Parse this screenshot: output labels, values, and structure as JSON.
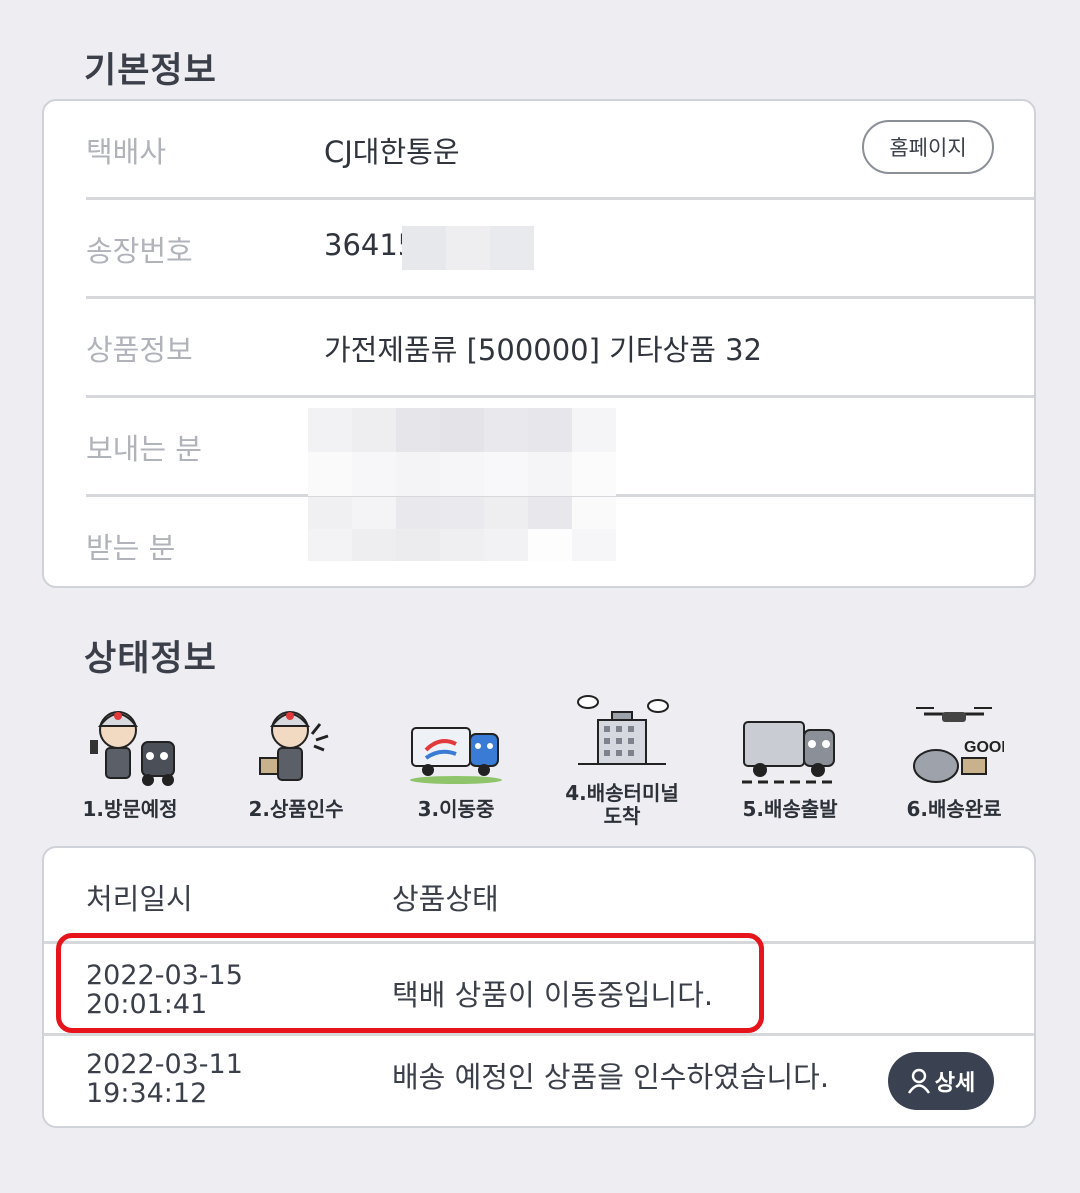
{
  "basic": {
    "title": "기본정보",
    "rows": [
      {
        "label": "택배사",
        "value": "CJ대한통운"
      },
      {
        "label": "송장번호",
        "value": "36415"
      },
      {
        "label": "상품정보",
        "value": "가전제품류 [500000] 기타상품 32"
      },
      {
        "label": "보내는 분",
        "value": ""
      },
      {
        "label": "받는 분",
        "value": ""
      }
    ],
    "homepage_button": "홈페이지"
  },
  "status": {
    "title": "상태정보",
    "steps": [
      {
        "label": "1.방문예정"
      },
      {
        "label": "2.상품인수"
      },
      {
        "label": "3.이동중"
      },
      {
        "label_line1": "4.배송터미널",
        "label_line2": "도착"
      },
      {
        "label": "5.배송출발"
      },
      {
        "label": "6.배송완료",
        "badge_text": "GOOD"
      }
    ]
  },
  "tracking": {
    "headers": {
      "datetime": "처리일시",
      "status": "상품상태"
    },
    "rows": [
      {
        "date": "2022-03-15",
        "time": "20:01:41",
        "status": "택배 상품이 이동중입니다."
      },
      {
        "date": "2022-03-11",
        "time": "19:34:12",
        "status": "배송 예정인 상품을 인수하였습니다.",
        "button": "상세"
      }
    ],
    "highlighted_row": 0
  },
  "colors": {
    "background": "#eeedf2",
    "highlight": "#e8141b",
    "detail_button": "#3a4150",
    "label_gray": "#b0b3ba"
  }
}
